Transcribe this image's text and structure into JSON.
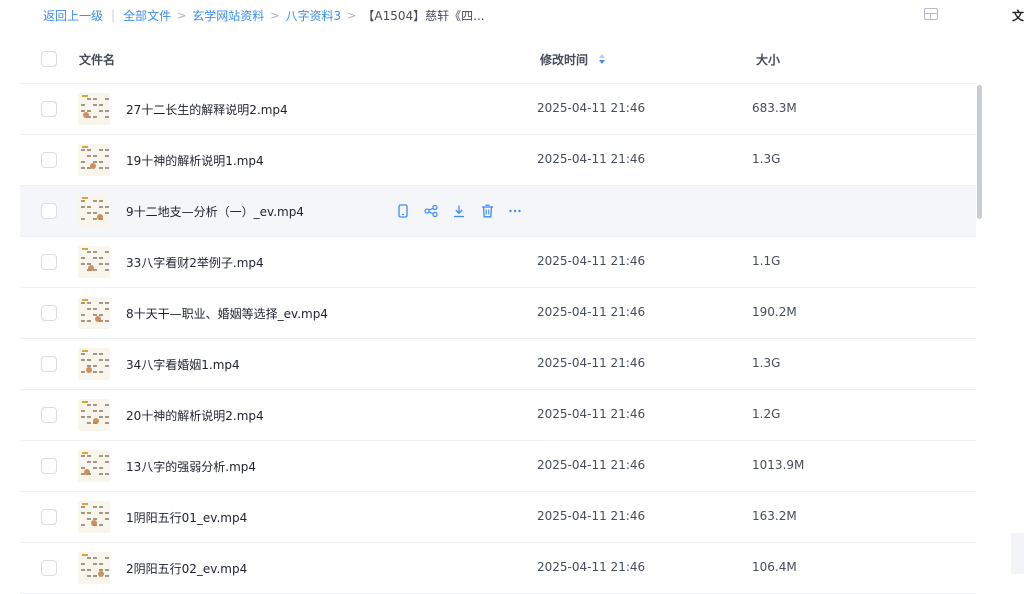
{
  "breadcrumb": {
    "back": "返回上一级",
    "items": [
      "全部文件",
      "玄学网站资料",
      "八字资料3"
    ],
    "current": "【A1504】慈轩《四..."
  },
  "right_panel": {
    "title": "文件"
  },
  "table": {
    "headers": {
      "name": "文件名",
      "modified": "修改时间",
      "size": "大小"
    },
    "sort": {
      "column": "modified",
      "direction": "desc"
    },
    "hovered_row": 2,
    "rows": [
      {
        "name": "27十二长生的解释说明2.mp4",
        "modified": "2025-04-11 21:46",
        "size": "683.3M"
      },
      {
        "name": "19十神的解析说明1.mp4",
        "modified": "2025-04-11 21:46",
        "size": "1.3G"
      },
      {
        "name": "9十二地支—分析（一）_ev.mp4",
        "modified": "",
        "size": ""
      },
      {
        "name": "33八字看财2举例子.mp4",
        "modified": "2025-04-11 21:46",
        "size": "1.1G"
      },
      {
        "name": "8十天干—职业、婚姻等选择_ev.mp4",
        "modified": "2025-04-11 21:46",
        "size": "190.2M"
      },
      {
        "name": "34八字看婚姻1.mp4",
        "modified": "2025-04-11 21:46",
        "size": "1.3G"
      },
      {
        "name": "20十神的解析说明2.mp4",
        "modified": "2025-04-11 21:46",
        "size": "1.2G"
      },
      {
        "name": "13八字的强弱分析.mp4",
        "modified": "2025-04-11 21:46",
        "size": "1013.9M"
      },
      {
        "name": "1阴阳五行01_ev.mp4",
        "modified": "2025-04-11 21:46",
        "size": "163.2M"
      },
      {
        "name": "2阴阳五行02_ev.mp4",
        "modified": "2025-04-11 21:46",
        "size": "106.4M"
      }
    ]
  },
  "row_actions": [
    "phone-icon",
    "share-icon",
    "download-icon",
    "delete-icon",
    "more-icon"
  ],
  "colors": {
    "accent": "#3a8ef6",
    "hover_row": "#f5f6fa",
    "divider": "#eef0f3"
  }
}
